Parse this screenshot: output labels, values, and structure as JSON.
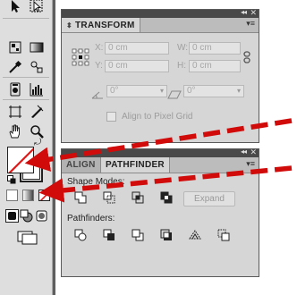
{
  "transform_panel": {
    "title": "TRANSFORM",
    "x_label": "X:",
    "x_value": "0 cm",
    "y_label": "Y:",
    "y_value": "0 cm",
    "w_label": "W:",
    "w_value": "0 cm",
    "h_label": "H:",
    "h_value": "0 cm",
    "rotate_value": "0°",
    "shear_value": "0°",
    "align_checkbox_label": "Align to Pixel Grid"
  },
  "pathfinder_panel": {
    "tabs": [
      "ALIGN",
      "PATHFINDER"
    ],
    "shape_modes_label": "Shape Modes:",
    "expand_label": "Expand",
    "pathfinders_label": "Pathfinders:"
  },
  "annotation": {
    "arrow_color": "#d10a0a"
  },
  "colors": {
    "fill_none_slash": "#e01818"
  }
}
